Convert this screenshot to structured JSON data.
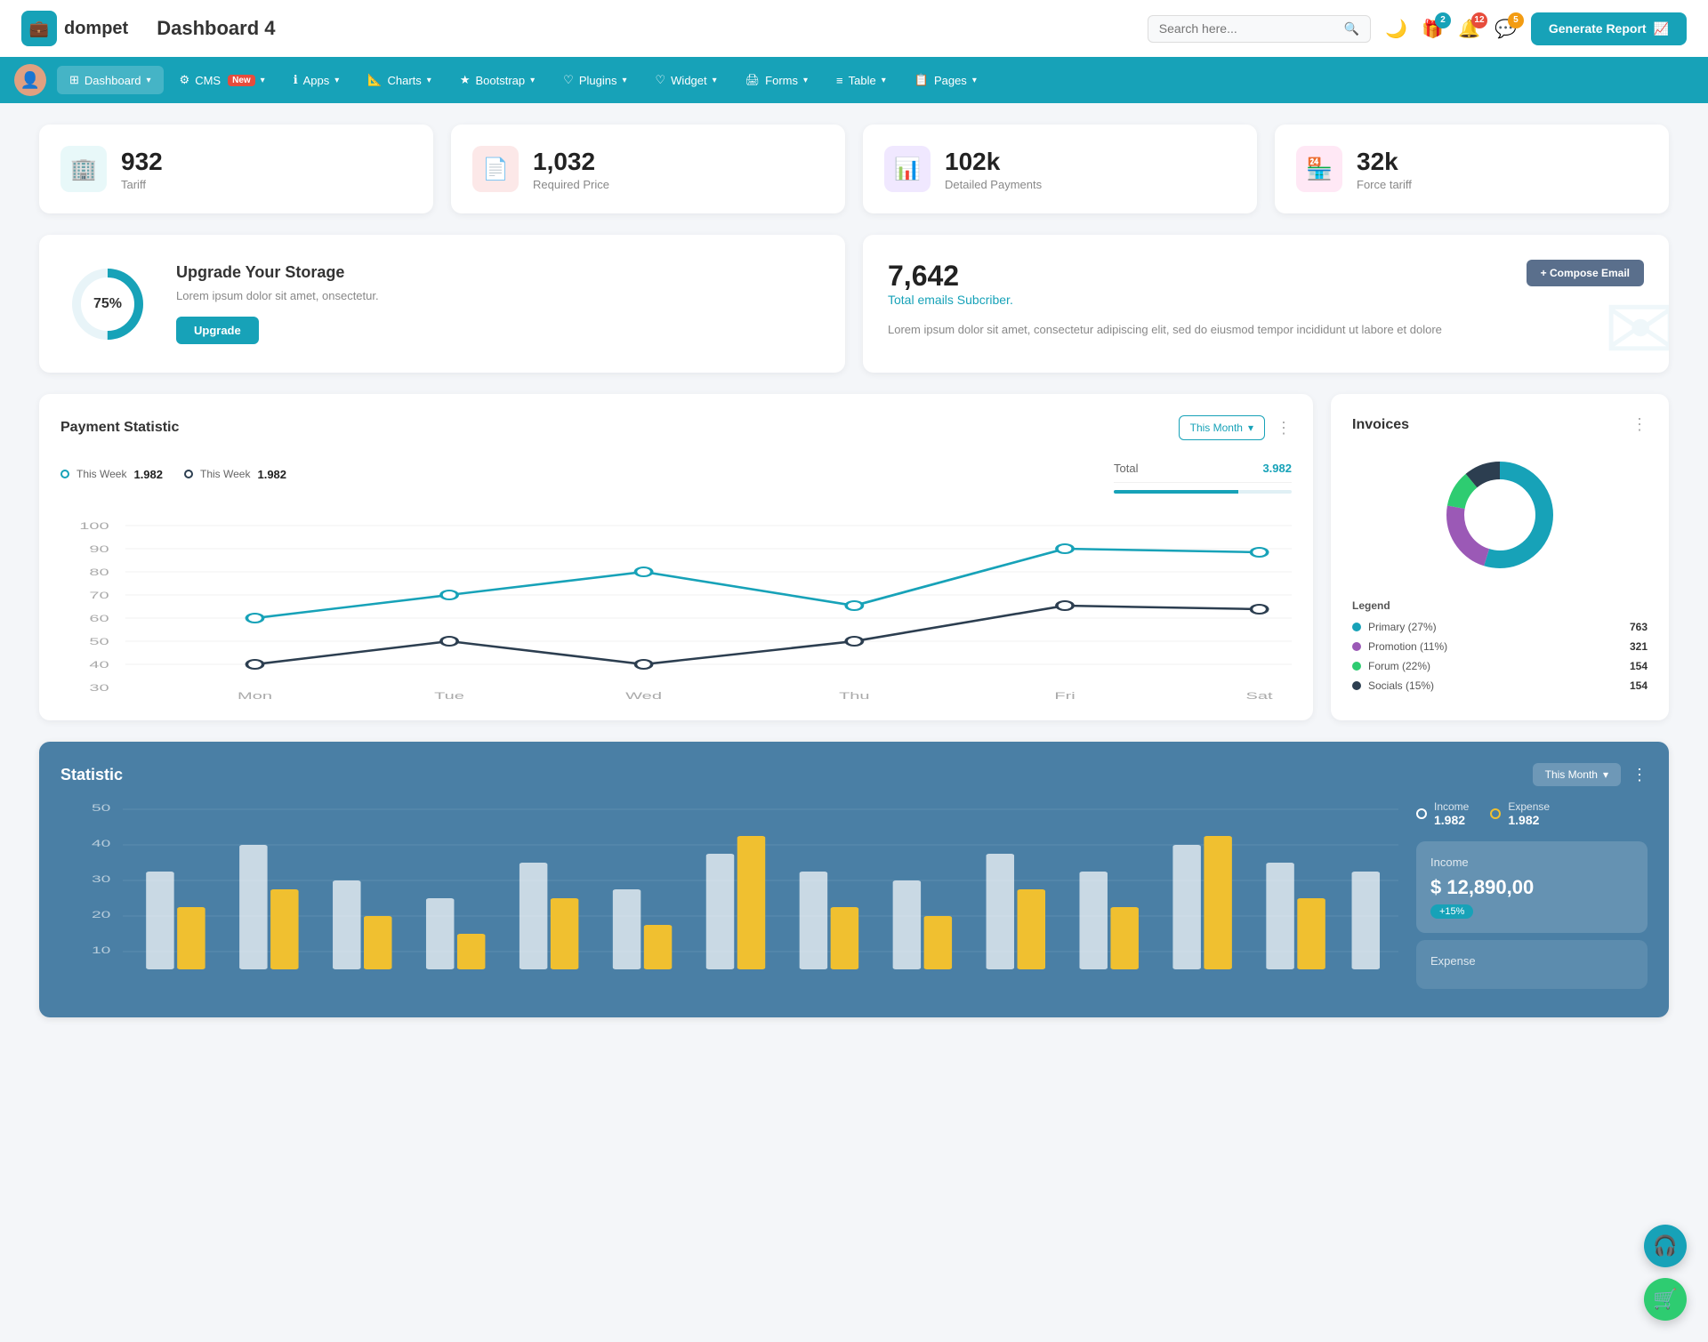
{
  "header": {
    "logo_text": "dompet",
    "page_title": "Dashboard 4",
    "search_placeholder": "Search here...",
    "generate_report_label": "Generate Report",
    "badges": {
      "gift": "2",
      "bell": "12",
      "chat": "5"
    }
  },
  "nav": {
    "items": [
      {
        "id": "dashboard",
        "label": "Dashboard",
        "has_chevron": true,
        "active": true
      },
      {
        "id": "cms",
        "label": "CMS",
        "has_chevron": true,
        "is_new": true,
        "badge_text": "New"
      },
      {
        "id": "apps",
        "label": "Apps",
        "has_chevron": true
      },
      {
        "id": "charts",
        "label": "Charts",
        "has_chevron": true
      },
      {
        "id": "bootstrap",
        "label": "Bootstrap",
        "has_chevron": true
      },
      {
        "id": "plugins",
        "label": "Plugins",
        "has_chevron": true
      },
      {
        "id": "widget",
        "label": "Widget",
        "has_chevron": true
      },
      {
        "id": "forms",
        "label": "Forms",
        "has_chevron": true
      },
      {
        "id": "table",
        "label": "Table",
        "has_chevron": true
      },
      {
        "id": "pages",
        "label": "Pages",
        "has_chevron": true
      }
    ]
  },
  "stat_cards": [
    {
      "id": "tariff",
      "value": "932",
      "label": "Tariff",
      "icon_type": "teal",
      "icon": "🏢"
    },
    {
      "id": "required_price",
      "value": "1,032",
      "label": "Required Price",
      "icon_type": "red",
      "icon": "📄"
    },
    {
      "id": "detailed_payments",
      "value": "102k",
      "label": "Detailed Payments",
      "icon_type": "purple",
      "icon": "📊"
    },
    {
      "id": "force_tariff",
      "value": "32k",
      "label": "Force tariff",
      "icon_type": "pink",
      "icon": "🏪"
    }
  ],
  "storage": {
    "percentage": "75%",
    "title": "Upgrade Your Storage",
    "description": "Lorem ipsum dolor sit amet, onsectetur.",
    "button_label": "Upgrade"
  },
  "email": {
    "count": "7,642",
    "subtitle": "Total emails Subcriber.",
    "description": "Lorem ipsum dolor sit amet, consectetur adipiscing elit, sed do eiusmod tempor incididunt ut labore et dolore",
    "compose_label": "+ Compose Email"
  },
  "payment_statistic": {
    "title": "Payment Statistic",
    "filter_label": "This Month",
    "legend": [
      {
        "label": "This Week",
        "value": "1.982",
        "color": "teal"
      },
      {
        "label": "This Week",
        "value": "1.982",
        "color": "dark"
      }
    ],
    "total_label": "Total",
    "total_value": "3.982",
    "x_labels": [
      "Mon",
      "Tue",
      "Wed",
      "Thu",
      "Fri",
      "Sat"
    ],
    "y_labels": [
      "100",
      "90",
      "80",
      "70",
      "60",
      "50",
      "40",
      "30"
    ],
    "series1": [
      60,
      70,
      80,
      65,
      90,
      88
    ],
    "series2": [
      40,
      50,
      40,
      50,
      65,
      63
    ]
  },
  "invoices": {
    "title": "Invoices",
    "legend": [
      {
        "label": "Primary (27%)",
        "value": "763",
        "color": "#17a2b8"
      },
      {
        "label": "Promotion (11%)",
        "value": "321",
        "color": "#9b59b6"
      },
      {
        "label": "Forum (22%)",
        "value": "154",
        "color": "#2ecc71"
      },
      {
        "label": "Socials (15%)",
        "value": "154",
        "color": "#2c3e50"
      }
    ],
    "legend_title": "Legend"
  },
  "statistic": {
    "title": "Statistic",
    "filter_label": "This Month",
    "income_label": "Income",
    "income_value": "1.982",
    "expense_label": "Expense",
    "expense_value": "1.982",
    "income_box_title": "Income",
    "income_amount": "$ 12,890,00",
    "income_badge": "+15%"
  },
  "fab": {
    "headset_icon": "🎧",
    "cart_icon": "🛒"
  }
}
